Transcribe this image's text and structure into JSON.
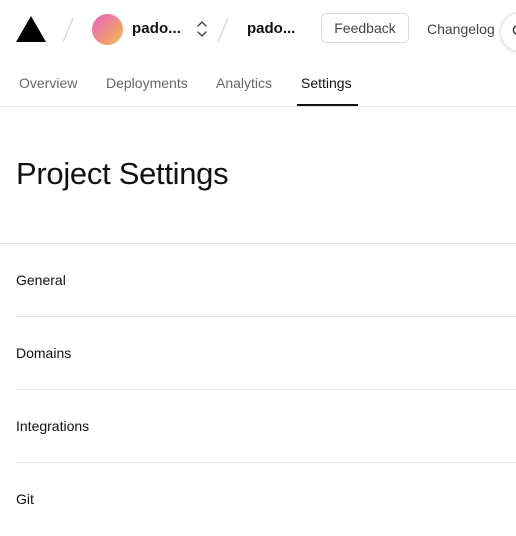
{
  "header": {
    "team_name": "pado...",
    "project_name": "pado...",
    "feedback_label": "Feedback",
    "changelog_label": "Changelog",
    "avatar_gradient": [
      "#e85fc7",
      "#f1a06a",
      "#f7c35a"
    ]
  },
  "tabs": [
    {
      "label": "Overview",
      "active": false
    },
    {
      "label": "Deployments",
      "active": false
    },
    {
      "label": "Analytics",
      "active": false
    },
    {
      "label": "Settings",
      "active": true
    }
  ],
  "page": {
    "title": "Project Settings"
  },
  "settings_nav": {
    "items": [
      {
        "label": "General"
      },
      {
        "label": "Domains"
      },
      {
        "label": "Integrations"
      },
      {
        "label": "Git"
      }
    ]
  },
  "colors": {
    "text": "#111111",
    "muted_text": "#666666",
    "border": "#e5e5e5"
  }
}
